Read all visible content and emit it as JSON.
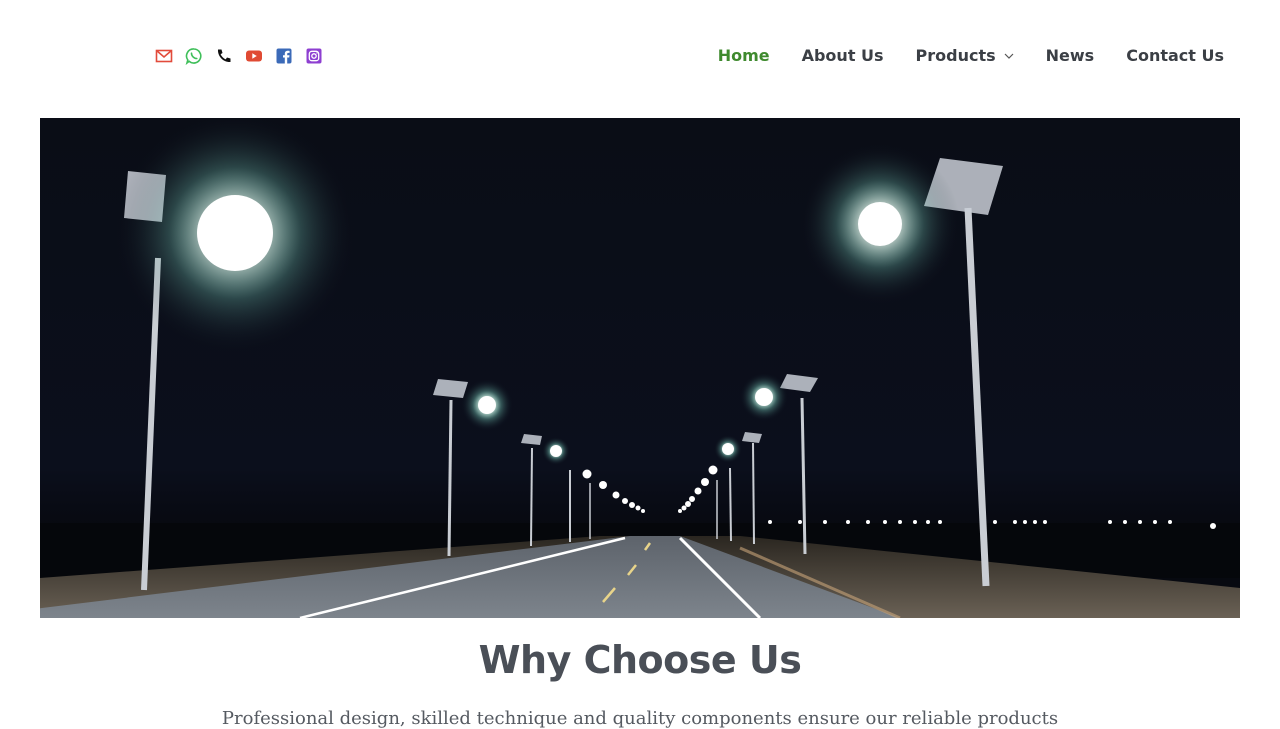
{
  "header": {
    "social": [
      {
        "name": "email-icon",
        "color": "#e24b3b"
      },
      {
        "name": "whatsapp-icon",
        "color": "#3fbf5a"
      },
      {
        "name": "phone-icon",
        "color": "#111111"
      },
      {
        "name": "youtube-icon",
        "color": "#e04a33"
      },
      {
        "name": "facebook-icon",
        "color": "#3b6ab8"
      },
      {
        "name": "instagram-icon",
        "color": "#8e3fd1"
      }
    ],
    "nav": {
      "home": "Home",
      "about": "About Us",
      "products": "Products",
      "news": "News",
      "contact": "Contact Us"
    },
    "active_color": "#3f8a2e",
    "text_color": "#3b3f45"
  },
  "hero": {
    "image": "night road with solar street lights"
  },
  "section": {
    "title": "Why Choose Us",
    "subtitle": "Professional design, skilled technique and quality components ensure our reliable products"
  }
}
